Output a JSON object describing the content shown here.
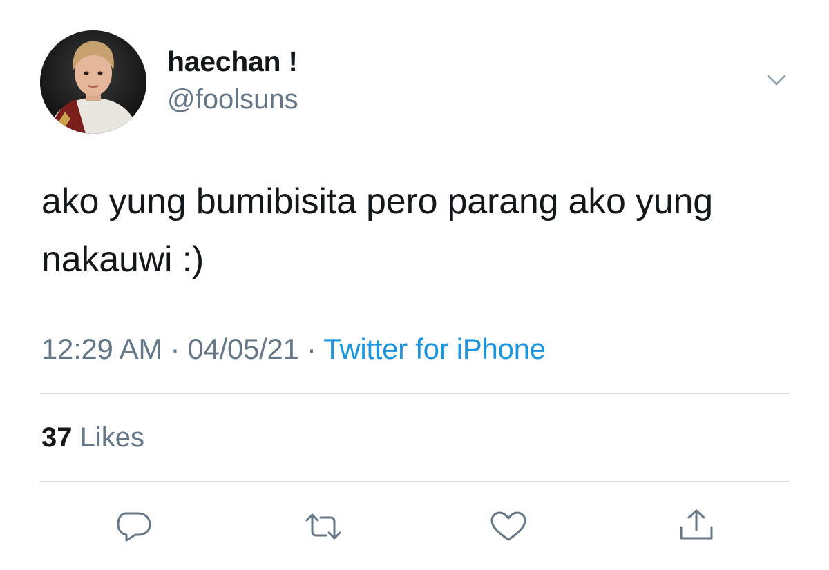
{
  "user": {
    "display_name": "haechan !",
    "handle": "@foolsuns"
  },
  "tweet": {
    "text": "ako yung bumibisita pero parang ako yung nakauwi :)",
    "time": "12:29 AM",
    "separator": "·",
    "date": "04/05/21",
    "source": "Twitter for iPhone"
  },
  "stats": {
    "likes_count": "37",
    "likes_label": "Likes"
  },
  "icons": {
    "caret": "chevron-down-icon",
    "reply": "reply-icon",
    "retweet": "retweet-icon",
    "like": "heart-icon",
    "share": "share-icon"
  },
  "colors": {
    "text": "#14171a",
    "secondary": "#657786",
    "link": "#1b95e0",
    "divider": "#d6dadd"
  }
}
